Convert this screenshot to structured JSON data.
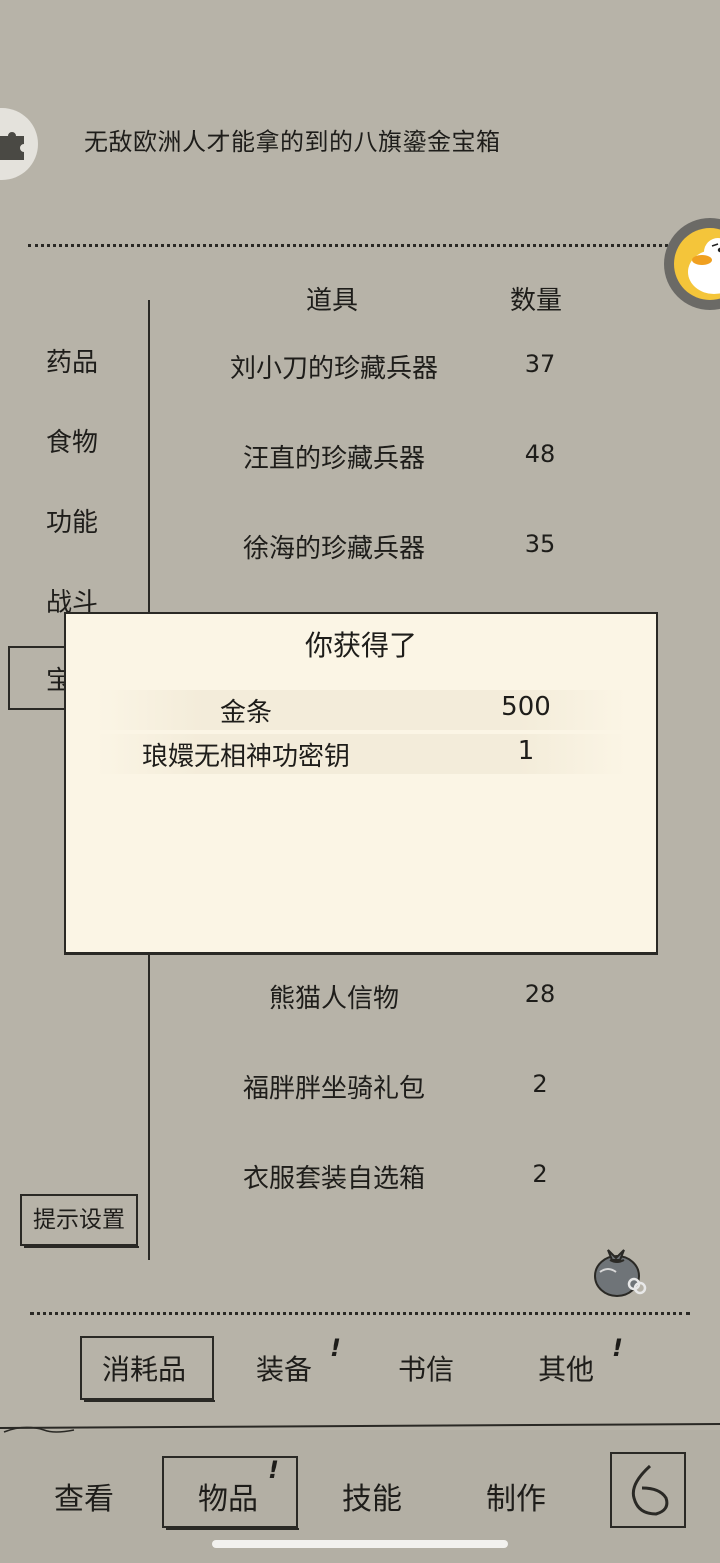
{
  "header": {
    "item_description": "无敌欧洲人才能拿的到的八旗鎏金宝箱"
  },
  "table": {
    "col_item": "道具",
    "col_qty": "数量",
    "rows_top": [
      {
        "name": "刘小刀的珍藏兵器",
        "qty": "37"
      },
      {
        "name": "汪直的珍藏兵器",
        "qty": "48"
      },
      {
        "name": "徐海的珍藏兵器",
        "qty": "35"
      }
    ],
    "rows_bottom": [
      {
        "name": "熊猫人信物",
        "qty": "28"
      },
      {
        "name": "福胖胖坐骑礼包",
        "qty": "2"
      },
      {
        "name": "衣服套装自选箱",
        "qty": "2"
      }
    ]
  },
  "categories": {
    "medicine": "药品",
    "food": "食物",
    "function": "功能",
    "combat": "战斗",
    "treasure_partial": "宝"
  },
  "hint_button": "提示设置",
  "modal": {
    "title": "你获得了",
    "rewards": [
      {
        "name": "金条",
        "qty": "500"
      },
      {
        "name": "琅嬛无相神功密钥",
        "qty": "1"
      }
    ]
  },
  "sub_tabs": {
    "consumables": "消耗品",
    "equipment": "装备",
    "letters": "书信",
    "other": "其他",
    "alert_mark": "!"
  },
  "bottom_nav": {
    "view": "查看",
    "items": "物品",
    "skills": "技能",
    "craft": "制作"
  },
  "icons": {
    "header_icon": "puzzle-icon",
    "mascot": "duck-mascot-icon",
    "bag": "money-bag-icon",
    "back": "back-arrow-icon"
  },
  "colors": {
    "background": "#b7b3a8",
    "modal_bg": "#fbf5e5",
    "ink": "#2a2925",
    "mascot_yellow": "#f4c53a"
  }
}
